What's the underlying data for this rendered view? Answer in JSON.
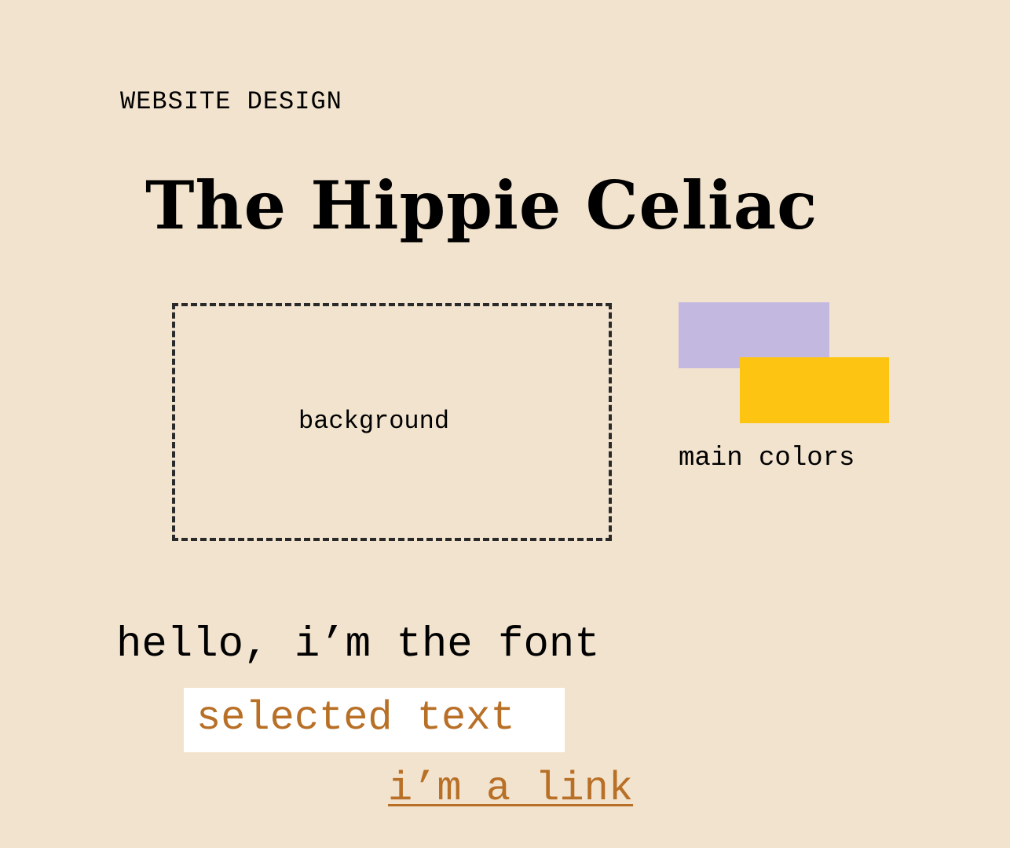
{
  "header": {
    "label": "WEBSITE DESIGN",
    "title": "The Hippie Celiac"
  },
  "background_sample": {
    "label": "background",
    "color": "#f2e3ce"
  },
  "main_colors": {
    "label": "main colors",
    "swatches": [
      "#c3b8e0",
      "#fdc412"
    ]
  },
  "typography": {
    "font_sample": "hello, i’m the font",
    "selected_text": "selected text",
    "selected_text_color": "#b86f26",
    "selection_background": "#ffffff",
    "link_text": "i’m a link",
    "link_color": "#b86f26"
  }
}
